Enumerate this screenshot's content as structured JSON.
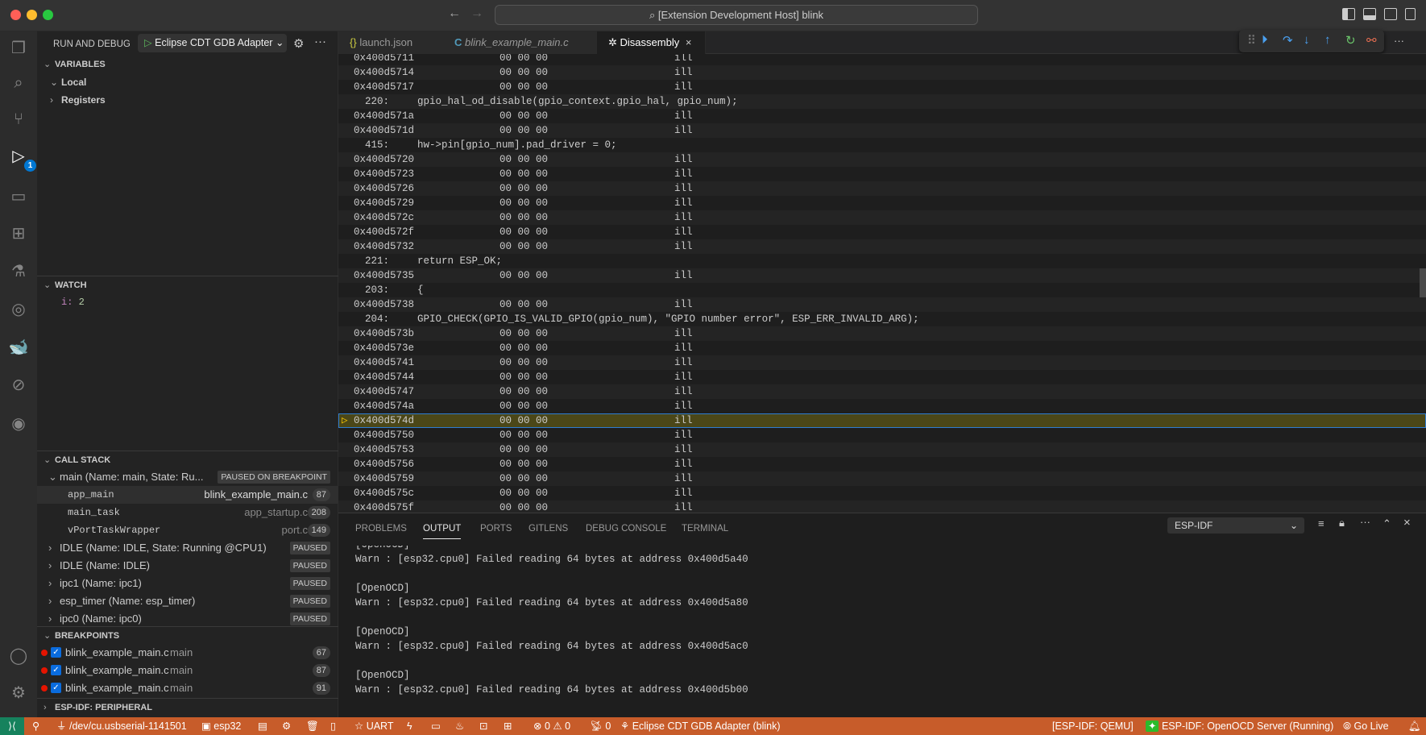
{
  "window": {
    "title": "[Extension Development Host] blink"
  },
  "sidebar": {
    "title": "RUN AND DEBUG",
    "config": "Eclipse CDT GDB Adapter",
    "variables": {
      "header": "VARIABLES",
      "items": [
        {
          "label": "Local",
          "expanded": true
        },
        {
          "label": "Registers",
          "expanded": false
        }
      ]
    },
    "watch": {
      "header": "WATCH",
      "items": [
        {
          "name": "i",
          "value": "2"
        }
      ]
    },
    "callstack": {
      "header": "CALL STACK",
      "threads": [
        {
          "label": "main (Name: main, State: Ru...",
          "status": "PAUSED ON BREAKPOINT",
          "expanded": true
        },
        {
          "label": "IDLE (Name: IDLE, State: Running @CPU1)",
          "status": "PAUSED"
        },
        {
          "label": "IDLE (Name: IDLE)",
          "status": "PAUSED"
        },
        {
          "label": "ipc1 (Name: ipc1)",
          "status": "PAUSED"
        },
        {
          "label": "esp_timer (Name: esp_timer)",
          "status": "PAUSED"
        },
        {
          "label": "ipc0 (Name: ipc0)",
          "status": "PAUSED"
        }
      ],
      "frames": [
        {
          "fn": "app_main",
          "file": "blink_example_main.c",
          "line": "87"
        },
        {
          "fn": "main_task",
          "file": "app_startup.c",
          "line": "208"
        },
        {
          "fn": "vPortTaskWrapper",
          "file": "port.c",
          "line": "149"
        }
      ]
    },
    "breakpoints": {
      "header": "BREAKPOINTS",
      "items": [
        {
          "file": "blink_example_main.c",
          "fn": "main",
          "line": "67"
        },
        {
          "file": "blink_example_main.c",
          "fn": "main",
          "line": "87"
        },
        {
          "file": "blink_example_main.c",
          "fn": "main",
          "line": "91"
        }
      ]
    },
    "peripheral": {
      "header": "ESP-IDF: PERIPHERAL"
    }
  },
  "tabs": [
    {
      "label": "launch.json",
      "icon": "{}"
    },
    {
      "label": "blink_example_main.c",
      "icon": "C"
    },
    {
      "label": "Disassembly",
      "active": true
    }
  ],
  "disassembly": [
    {
      "a": "0x400d5711",
      "b": "00 00 00",
      "i": "ill"
    },
    {
      "a": "0x400d5714",
      "b": "00 00 00",
      "i": "ill"
    },
    {
      "a": "0x400d5717",
      "b": "00 00 00",
      "i": "ill"
    },
    {
      "src": "220:",
      "code": "gpio_hal_od_disable(gpio_context.gpio_hal, gpio_num);"
    },
    {
      "a": "0x400d571a",
      "b": "00 00 00",
      "i": "ill"
    },
    {
      "a": "0x400d571d",
      "b": "00 00 00",
      "i": "ill"
    },
    {
      "src": "415:",
      "code": "hw->pin[gpio_num].pad_driver = 0;"
    },
    {
      "a": "0x400d5720",
      "b": "00 00 00",
      "i": "ill"
    },
    {
      "a": "0x400d5723",
      "b": "00 00 00",
      "i": "ill"
    },
    {
      "a": "0x400d5726",
      "b": "00 00 00",
      "i": "ill"
    },
    {
      "a": "0x400d5729",
      "b": "00 00 00",
      "i": "ill"
    },
    {
      "a": "0x400d572c",
      "b": "00 00 00",
      "i": "ill"
    },
    {
      "a": "0x400d572f",
      "b": "00 00 00",
      "i": "ill"
    },
    {
      "a": "0x400d5732",
      "b": "00 00 00",
      "i": "ill"
    },
    {
      "src": "221:",
      "code": "return ESP_OK;"
    },
    {
      "a": "0x400d5735",
      "b": "00 00 00",
      "i": "ill"
    },
    {
      "src": "203:",
      "code": "{"
    },
    {
      "a": "0x400d5738",
      "b": "00 00 00",
      "i": "ill"
    },
    {
      "src": "204:",
      "code": "GPIO_CHECK(GPIO_IS_VALID_GPIO(gpio_num), \"GPIO number error\", ESP_ERR_INVALID_ARG);"
    },
    {
      "a": "0x400d573b",
      "b": "00 00 00",
      "i": "ill"
    },
    {
      "a": "0x400d573e",
      "b": "00 00 00",
      "i": "ill"
    },
    {
      "a": "0x400d5741",
      "b": "00 00 00",
      "i": "ill"
    },
    {
      "a": "0x400d5744",
      "b": "00 00 00",
      "i": "ill"
    },
    {
      "a": "0x400d5747",
      "b": "00 00 00",
      "i": "ill"
    },
    {
      "a": "0x400d574a",
      "b": "00 00 00",
      "i": "ill"
    },
    {
      "a": "0x400d574d",
      "b": "00 00 00",
      "i": "ill",
      "current": true
    },
    {
      "a": "0x400d5750",
      "b": "00 00 00",
      "i": "ill"
    },
    {
      "a": "0x400d5753",
      "b": "00 00 00",
      "i": "ill"
    },
    {
      "a": "0x400d5756",
      "b": "00 00 00",
      "i": "ill"
    },
    {
      "a": "0x400d5759",
      "b": "00 00 00",
      "i": "ill"
    },
    {
      "a": "0x400d575c",
      "b": "00 00 00",
      "i": "ill"
    },
    {
      "a": "0x400d575f",
      "b": "00 00 00",
      "i": "ill"
    }
  ],
  "panel": {
    "tabs": [
      "PROBLEMS",
      "OUTPUT",
      "PORTS",
      "GITLENS",
      "DEBUG CONSOLE",
      "TERMINAL"
    ],
    "active": "OUTPUT",
    "channel": "ESP-IDF",
    "lines": [
      "[OpenOCD]",
      "Warn : [esp32.cpu0] Failed reading 64 bytes at address 0x400d5a40",
      "",
      "[OpenOCD]",
      "Warn : [esp32.cpu0] Failed reading 64 bytes at address 0x400d5a80",
      "",
      "[OpenOCD]",
      "Warn : [esp32.cpu0] Failed reading 64 bytes at address 0x400d5ac0",
      "",
      "[OpenOCD]",
      "Warn : [esp32.cpu0] Failed reading 64 bytes at address 0x400d5b00"
    ]
  },
  "status": {
    "port": "/dev/cu.usbserial-1141501",
    "target": "esp32",
    "uart": "UART",
    "errors": "0",
    "warnings": "0",
    "ports": "0",
    "debug": "Eclipse CDT GDB Adapter (blink)",
    "qemu": "[ESP-IDF: QEMU]",
    "openocd": "ESP-IDF: OpenOCD Server (Running)",
    "golive": "Go Live"
  },
  "colors": {
    "statusbar": "#c75c2a",
    "accent": "#0078d4",
    "current_line": "#4b4718",
    "breakpoint": "#e51400"
  }
}
